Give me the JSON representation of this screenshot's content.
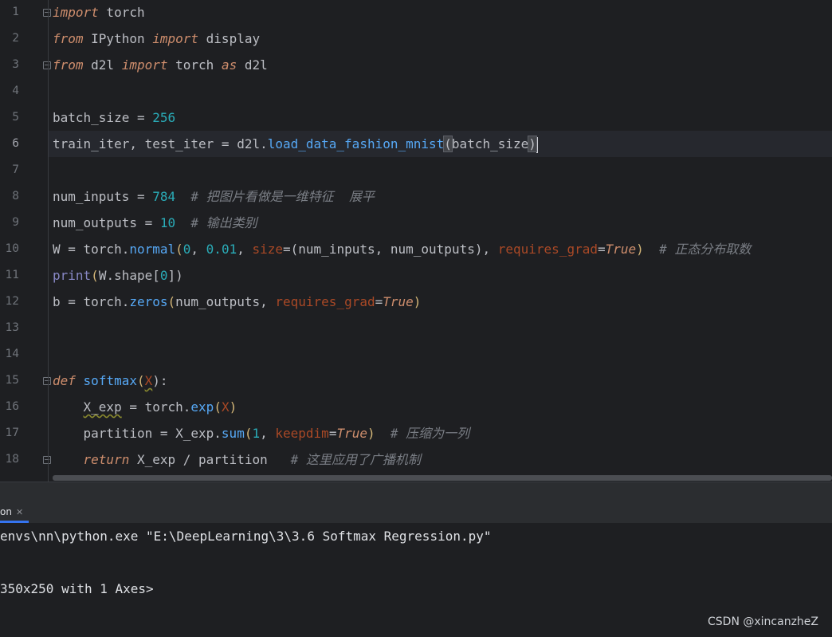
{
  "editor": {
    "line_numbers": [
      "1",
      "2",
      "3",
      "4",
      "5",
      "6",
      "7",
      "8",
      "9",
      "10",
      "11",
      "12",
      "13",
      "14",
      "15",
      "16",
      "17",
      "18"
    ],
    "l1": {
      "kw": "import",
      "rest": " torch"
    },
    "l2": {
      "kw1": "from",
      "mid": " IPython ",
      "kw2": "import",
      "rest": " display"
    },
    "l3": {
      "kw1": "from",
      "mid": " d2l ",
      "kw2": "import",
      "mid2": " torch ",
      "kw3": "as",
      "rest": " d2l"
    },
    "l5": {
      "text": "batch_size = ",
      "num": "256"
    },
    "l6": {
      "pre": "train_iter, test_iter = d2l.",
      "fn": "load_data_fashion_mnist",
      "open": "(",
      "arg": "batch_size",
      "close": ")"
    },
    "l8": {
      "text": "num_inputs = ",
      "num": "784",
      "cmt": "  # 把图片看做是一维特征  展平"
    },
    "l9": {
      "text": "num_outputs = ",
      "num": "10",
      "cmt": "  # 输出类别"
    },
    "l10": {
      "pre": "W = torch.",
      "fn": "normal",
      "o1": "(",
      "n1": "0",
      "c1": ", ",
      "n2": "0.01",
      "c2": ", ",
      "kw1": "size",
      "eq1": "=",
      "o2": "(",
      "args": "num_inputs, num_outputs",
      "cl2": ")",
      "c3": ", ",
      "kw2": "requires_grad",
      "eq2": "=",
      "val": "True",
      "cl1": ")",
      "cmt": "  # 正态分布取数"
    },
    "l11": {
      "fn": "print",
      "o": "(",
      "mid": "W.shape[",
      "num": "0",
      "close": "])"
    },
    "l12": {
      "pre": "b = torch.",
      "fn": "zeros",
      "o": "(",
      "arg": "num_outputs, ",
      "kw": "requires_grad",
      "eq": "=",
      "val": "True",
      "close": ")"
    },
    "l15": {
      "kw": "def",
      "sp": " ",
      "fn": "softmax",
      "o": "(",
      "param": "X",
      "close": "):"
    },
    "l16": {
      "ind": "    ",
      "var": "X_exp",
      "mid": " = torch.",
      "fn": "exp",
      "o": "(",
      "arg": "X",
      "close": ")"
    },
    "l17": {
      "ind": "    ",
      "pre": "partition = X_exp.",
      "fn": "sum",
      "o": "(",
      "num": "1",
      "c": ", ",
      "kw": "keepdim",
      "eq": "=",
      "val": "True",
      "close": ")",
      "cmt": "  # 压缩为一列"
    },
    "l18": {
      "ind": "    ",
      "kw": "return",
      "rest": " X_exp / partition",
      "cmt": "   # 这里应用了广播机制"
    }
  },
  "run_panel": {
    "tab_label": "on",
    "console_lines": [
      "envs\\nn\\python.exe \"E:\\DeepLearning\\3\\3.6 Softmax Regression.py\"",
      "",
      "350x250 with 1 Axes>"
    ]
  },
  "watermark": "CSDN @xincanzheZ",
  "colors": {
    "background": "#1e1f22",
    "keyword": "#cf8e6d",
    "function": "#56a8f5",
    "number": "#2aacb8",
    "comment": "#7a7e85",
    "accent": "#3574f0"
  }
}
